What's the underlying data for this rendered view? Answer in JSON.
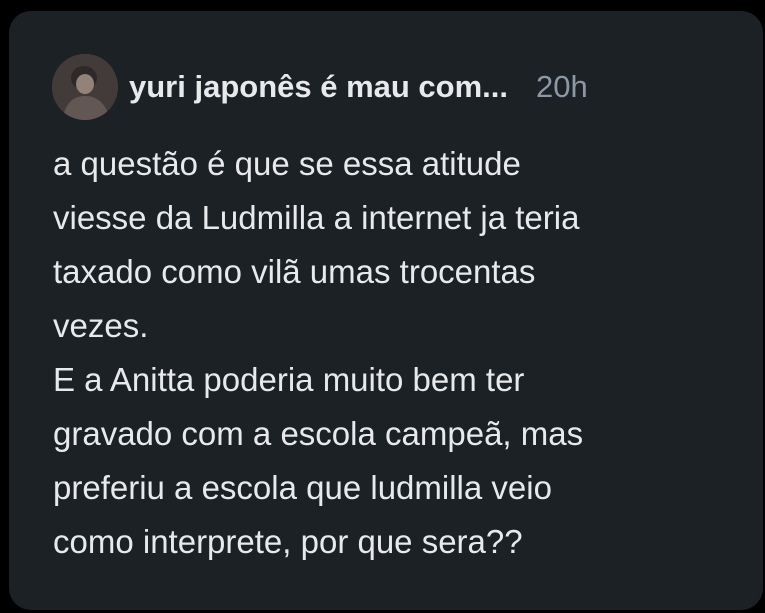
{
  "tweet": {
    "author_name": "yuri japonês é mau com...",
    "time": "20h",
    "paragraphs": [
      "a questão é que se essa atitude\nviesse da Ludmilla a internet ja teria\ntaxado como vilã umas trocentas\nvezes.",
      "E a Anitta poderia muito bem ter\ngravado com a escola campeã, mas\npreferiu a escola que ludmilla veio\ncomo interprete, por que sera??"
    ]
  },
  "colors": {
    "background": "#000000",
    "card": "#1c2126",
    "text_primary": "#e7e9ea",
    "text_secondary": "#8b98a5"
  }
}
